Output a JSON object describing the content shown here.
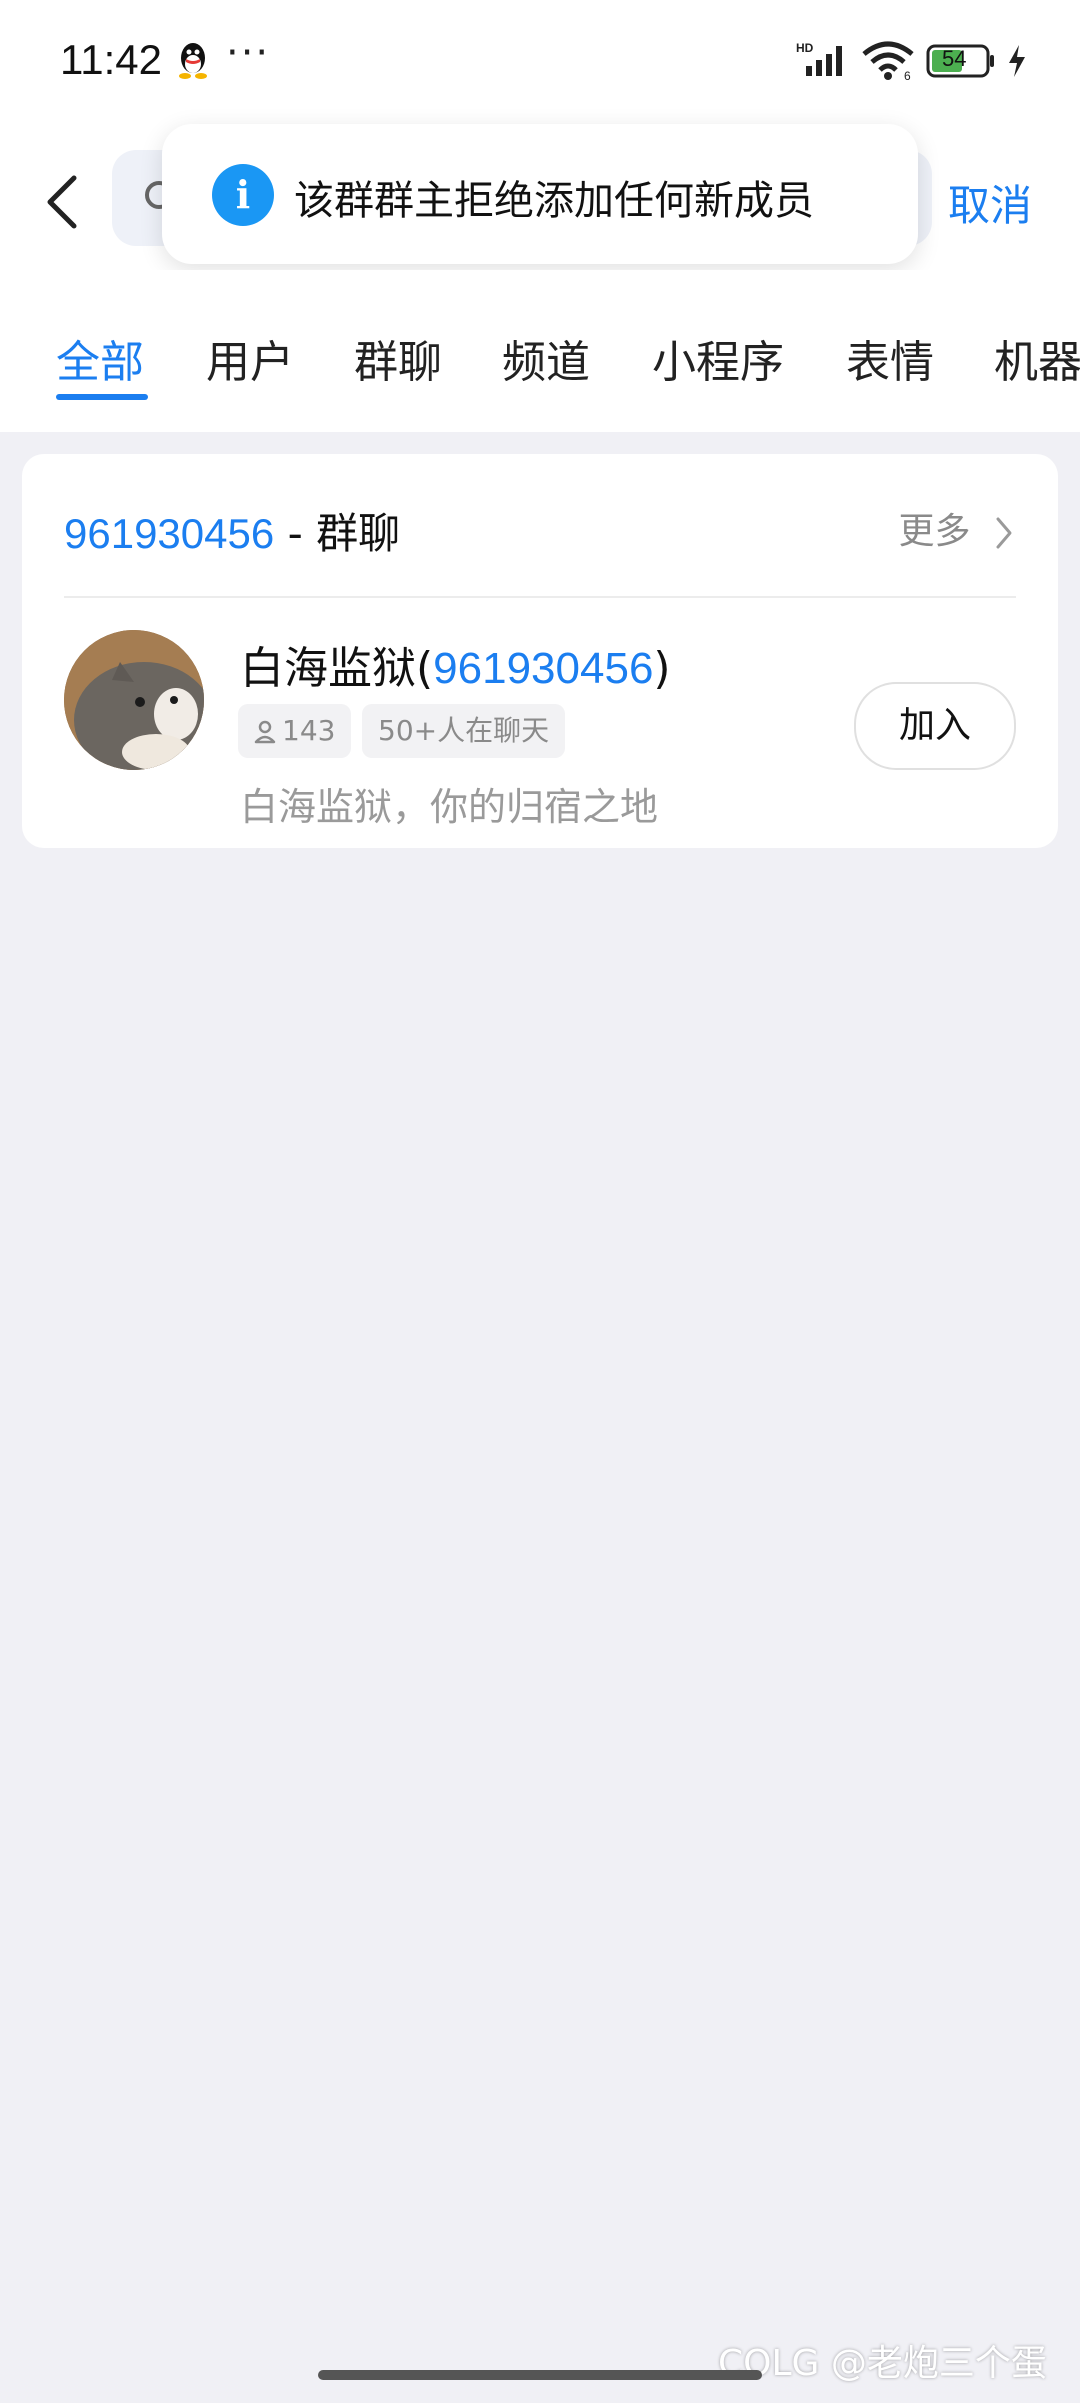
{
  "status_bar": {
    "time": "11:42",
    "more": "···",
    "network_label": "HD",
    "battery": "54",
    "icons": [
      "qq-icon",
      "signal-icon",
      "wifi-icon",
      "battery-icon",
      "charging-icon"
    ]
  },
  "header": {
    "back_icon": "chevron-left-icon",
    "search_icon": "search-icon",
    "cancel_label": "取消"
  },
  "toast": {
    "icon": "info-icon",
    "icon_glyph": "i",
    "message": "该群群主拒绝添加任何新成员"
  },
  "tabs": [
    {
      "label": "全部",
      "active": true
    },
    {
      "label": "用户",
      "active": false
    },
    {
      "label": "群聊",
      "active": false
    },
    {
      "label": "频道",
      "active": false
    },
    {
      "label": "小程序",
      "active": false
    },
    {
      "label": "表情",
      "active": false
    },
    {
      "label": "机器",
      "active": false
    }
  ],
  "result_section": {
    "query_number": "961930456",
    "title_suffix": " - 群聊",
    "more_label": "更多",
    "item": {
      "name": "白海监狱(",
      "number": "961930456",
      "name_close": ")",
      "members": "143",
      "active_tag": "50+人在聊天",
      "description": "白海监狱，你的归宿之地",
      "join_label": "加入"
    }
  },
  "watermark": "COLG @老炮三个蛋",
  "colors": {
    "accent": "#1b7ef0",
    "background": "#f0f0f5",
    "info_blue": "#1a97f4"
  }
}
